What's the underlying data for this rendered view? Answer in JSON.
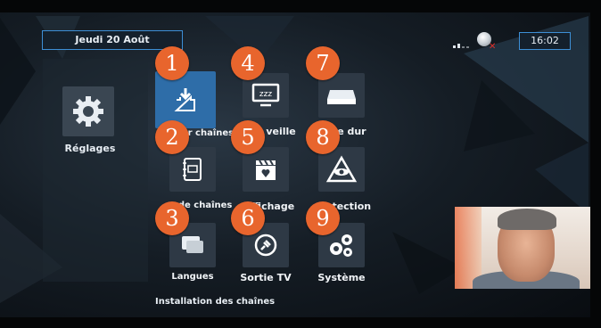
{
  "header": {
    "date": "Jeudi 20 Août",
    "time": "16:02"
  },
  "status": {
    "signal_icon": "signal-bars-icon",
    "network_icon": "globe-disconnected-icon"
  },
  "sidebar": {
    "label": "Réglages",
    "icon": "gear-icon"
  },
  "menu": {
    "items": [
      {
        "number": "1",
        "label": "…er chaînes",
        "icon": "download-box-icon",
        "selected": true
      },
      {
        "number": "2",
        "label": "…e de chaînes",
        "icon": "channel-list-icon",
        "selected": false
      },
      {
        "number": "3",
        "label": "Langues",
        "icon": "speech-bubbles-icon",
        "selected": false
      },
      {
        "number": "4",
        "label": "…en veille",
        "icon": "tv-sleep-icon",
        "selected": false
      },
      {
        "number": "5",
        "label": "…ffichage",
        "icon": "clapper-heart-icon",
        "selected": false
      },
      {
        "number": "6",
        "label": "Sortie TV",
        "icon": "plug-output-icon",
        "selected": false
      },
      {
        "number": "7",
        "label": "…ue dur",
        "icon": "hard-disk-icon",
        "selected": false
      },
      {
        "number": "8",
        "label": "…otection",
        "icon": "eye-triangle-icon",
        "selected": false
      },
      {
        "number": "9",
        "label": "Système",
        "icon": "gears-icon",
        "selected": false
      }
    ]
  },
  "footer": {
    "description": "Installation des chaînes"
  },
  "preview": {
    "icon": "live-tv-preview"
  },
  "colors": {
    "accent": "#3d8fd6",
    "badge": "#e8652d",
    "selected_tile": "#2e6da8"
  }
}
